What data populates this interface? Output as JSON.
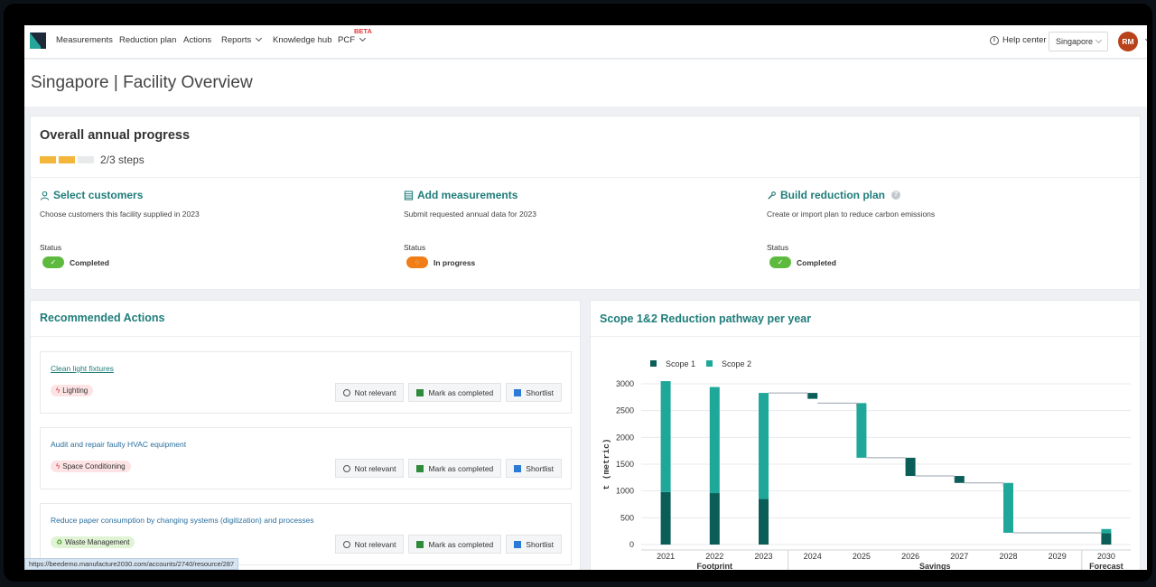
{
  "nav": {
    "items": [
      "Measurements",
      "Reduction plan",
      "Actions",
      "Reports",
      "Knowledge hub",
      "PCF"
    ],
    "beta": "BETA",
    "help": "Help center",
    "location_select": "Singapore",
    "avatar_initials": "RM"
  },
  "page": {
    "title": "Singapore | Facility Overview"
  },
  "progress": {
    "title": "Overall annual progress",
    "steps_text": "2/3 steps",
    "steps_done": 2,
    "steps_total": 3,
    "status_label": "Status",
    "steps": [
      {
        "title": "Select customers",
        "desc": "Choose customers this facility supplied in 2023",
        "status": "Completed",
        "icon": "user-icon"
      },
      {
        "title": "Add measurements",
        "desc": "Submit requested annual data for 2023",
        "status": "In progress",
        "icon": "table-icon"
      },
      {
        "title": "Build reduction plan",
        "desc": "Create or import plan to reduce carbon emissions",
        "status": "Completed",
        "icon": "wrench-icon"
      }
    ]
  },
  "recommended": {
    "title": "Recommended Actions",
    "buttons": {
      "not_relevant": "Not relevant",
      "mark_completed": "Mark as completed",
      "shortlist": "Shortlist"
    },
    "actions": [
      {
        "title": "Clean light fixtures",
        "tag": "Lighting"
      },
      {
        "title": "Audit and repair faulty HVAC equipment",
        "tag": "Space Conditioning"
      },
      {
        "title": "Reduce paper consumption by changing systems (digitization) and processes",
        "tag": "Waste Management"
      }
    ]
  },
  "status_url": "https://beedemo.manufacture2030.com/accounts/2740/resource/287",
  "chart_data": {
    "type": "bar",
    "title": "Scope 1&2 Reduction pathway per year",
    "ylabel": "t (metric)",
    "ylim": [
      0,
      3000
    ],
    "yticks": [
      0,
      500,
      1000,
      1500,
      2000,
      2500,
      3000
    ],
    "categories": [
      "2021",
      "2022",
      "2023",
      "2024",
      "2025",
      "2026",
      "2027",
      "2028",
      "2029",
      "2030"
    ],
    "groups": [
      {
        "label": "Footprint",
        "categories": [
          "2021",
          "2022",
          "2023"
        ]
      },
      {
        "label": "Savings",
        "categories": [
          "2024",
          "2025",
          "2026",
          "2027",
          "2028",
          "2029"
        ]
      },
      {
        "label": "Forecast",
        "categories": [
          "2030"
        ]
      }
    ],
    "series": [
      {
        "name": "Scope 1",
        "color": "#0b5e57",
        "values": [
          980,
          960,
          850,
          null,
          null,
          1620,
          1200,
          null,
          null,
          210
        ]
      },
      {
        "name": "Scope 2",
        "color": "#1fa89a",
        "values": [
          2070,
          1980,
          1980,
          null,
          null,
          null,
          null,
          null,
          null,
          80
        ]
      }
    ],
    "savings": [
      {
        "category": "2024",
        "from": 2830,
        "to": 2720,
        "scope": "Scope 1"
      },
      {
        "category": "2025",
        "from": 2640,
        "to": 1620,
        "scope": "Scope 2"
      },
      {
        "category": "2026",
        "from": 1620,
        "to": 1280,
        "scope": "Scope 1"
      },
      {
        "category": "2027",
        "from": 1280,
        "to": 1150,
        "scope": "Scope 1"
      },
      {
        "category": "2028",
        "from": 1150,
        "to": 220,
        "scope": "Scope 2"
      }
    ]
  }
}
